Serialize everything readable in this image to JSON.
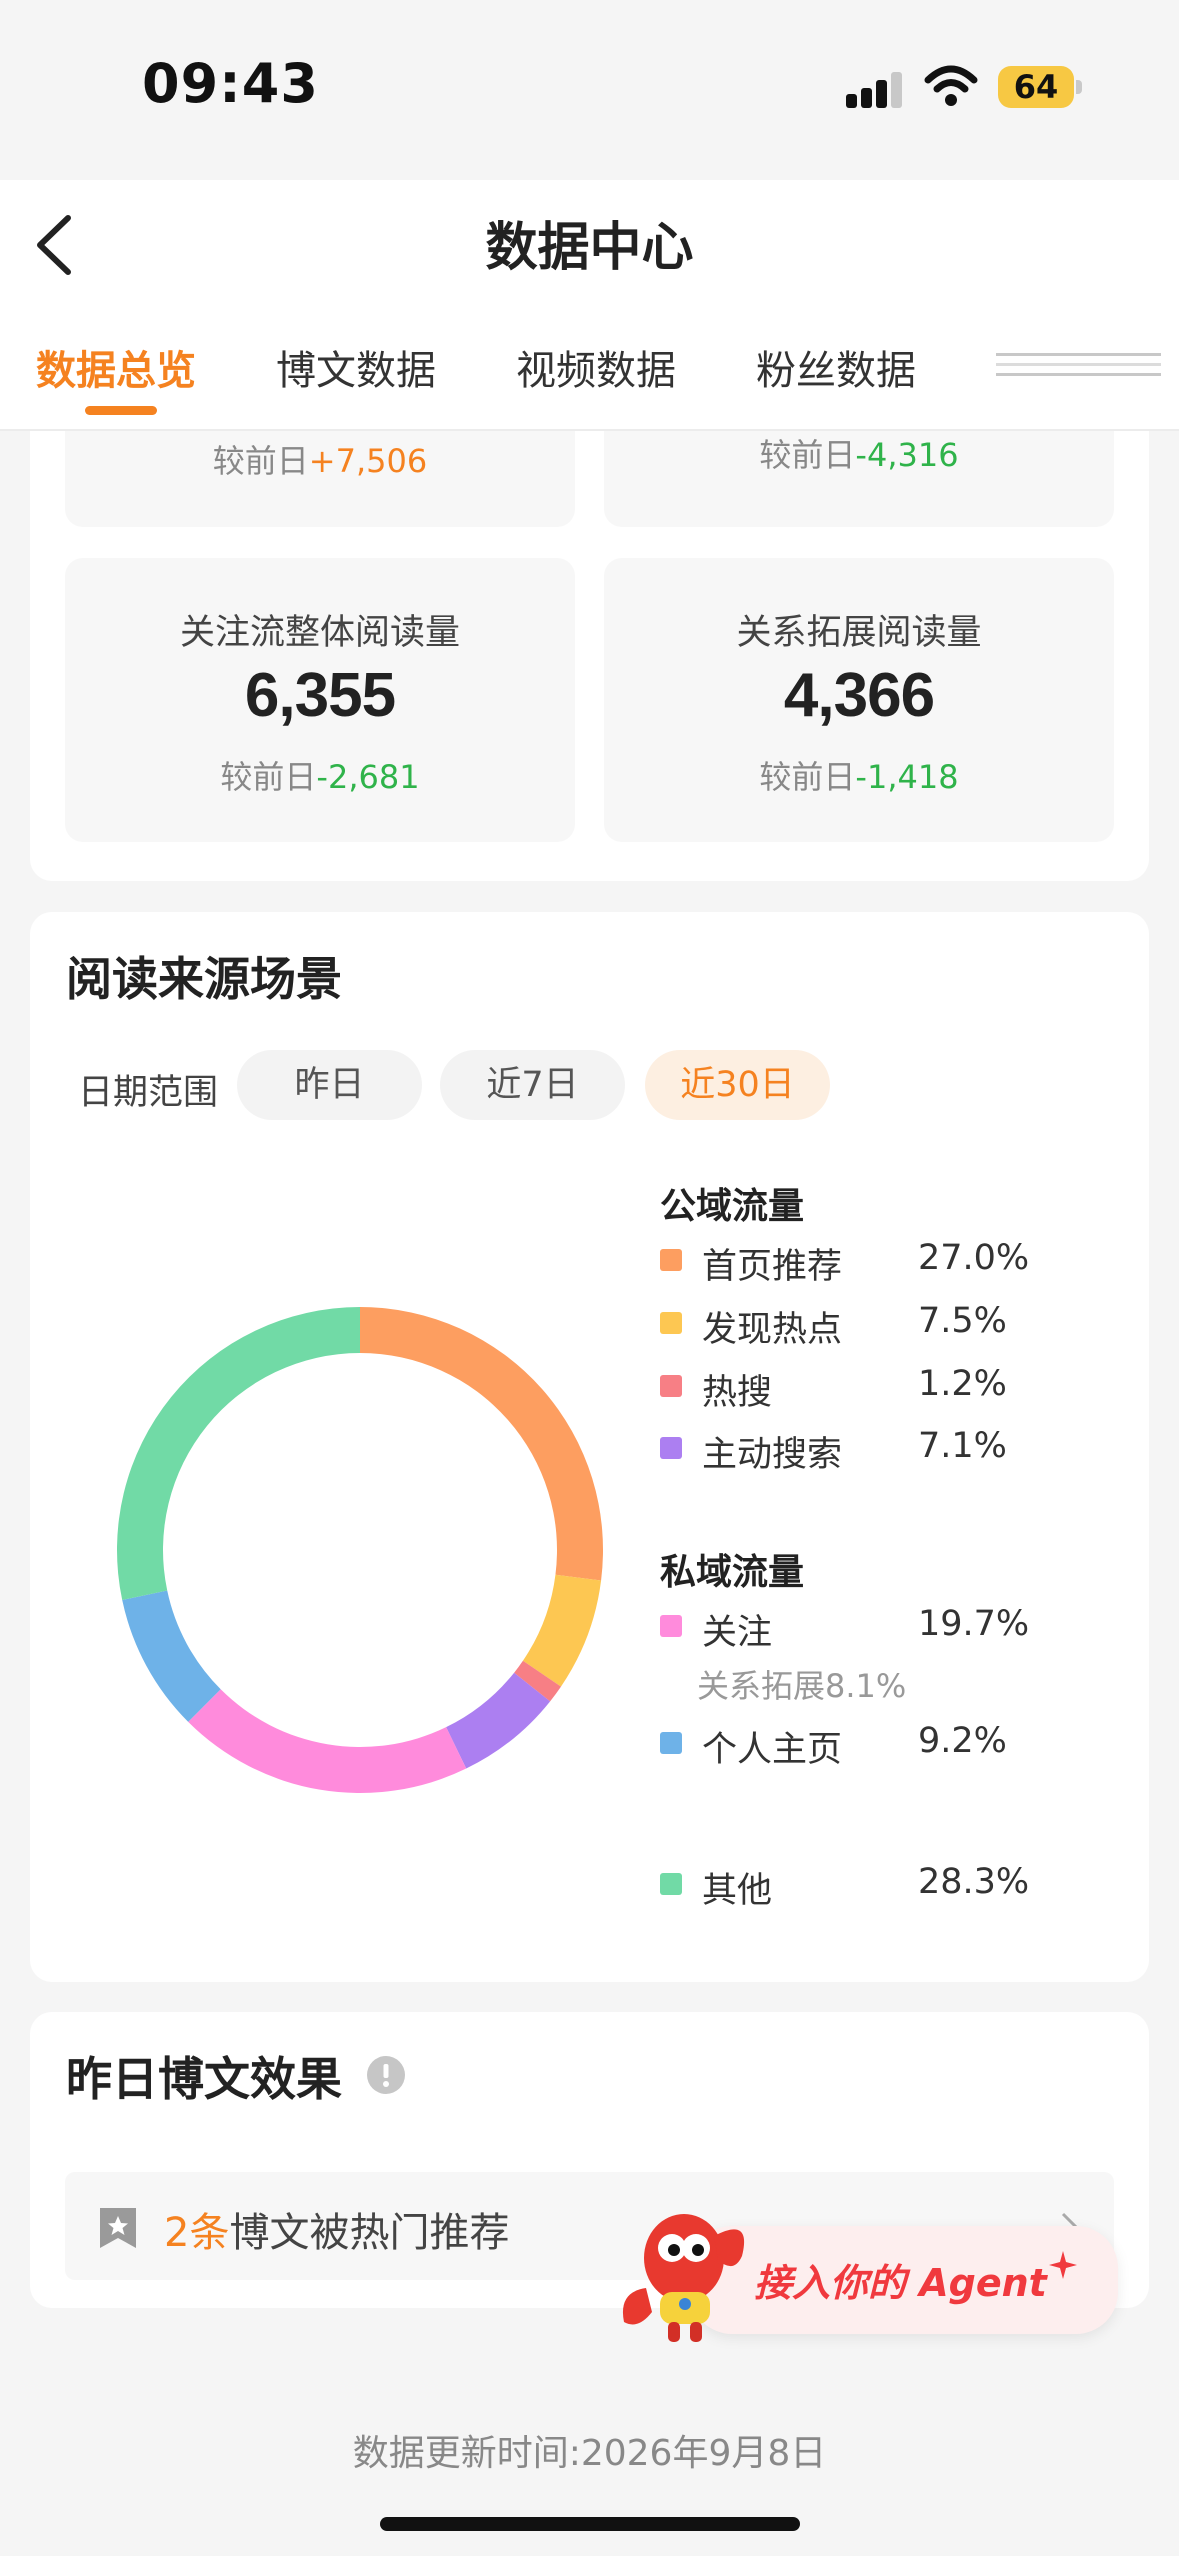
{
  "status_bar": {
    "time": "09:43",
    "battery": "64"
  },
  "header": {
    "title": "数据中心",
    "tabs": [
      {
        "label": "数据总览",
        "active": true
      },
      {
        "label": "博文数据",
        "active": false
      },
      {
        "label": "视频数据",
        "active": false
      },
      {
        "label": "粉丝数据",
        "active": false
      }
    ]
  },
  "overview": {
    "top_partial": [
      {
        "delta_label": "较前日",
        "delta": "+7,506"
      },
      {
        "delta_label": "较前日",
        "delta": "-4,316"
      }
    ],
    "stats": [
      {
        "label": "关注流整体阅读量",
        "value": "6,355",
        "delta_label": "较前日",
        "delta": "-2,681"
      },
      {
        "label": "关系拓展阅读量",
        "value": "4,366",
        "delta_label": "较前日",
        "delta": "-1,418"
      }
    ]
  },
  "sources": {
    "title": "阅读来源场景",
    "range_label": "日期范围",
    "ranges": [
      {
        "label": "昨日",
        "active": false
      },
      {
        "label": "近7日",
        "active": false
      },
      {
        "label": "近30日",
        "active": true
      }
    ],
    "public_title": "公域流量",
    "private_title": "私域流量",
    "public_items": [
      {
        "name": "首页推荐",
        "value": "27.0%",
        "color": "#fd9e60"
      },
      {
        "name": "发现热点",
        "value": "7.5%",
        "color": "#fdc752"
      },
      {
        "name": "热搜",
        "value": "1.2%",
        "color": "#f77f85"
      },
      {
        "name": "主动搜索",
        "value": "7.1%",
        "color": "#ac7ff1"
      }
    ],
    "private_items": [
      {
        "name": "关注",
        "value": "19.7%",
        "color": "#ff8bdc",
        "sub": "关系拓展8.1%"
      },
      {
        "name": "个人主页",
        "value": "9.2%",
        "color": "#6eb2e8"
      }
    ],
    "other_item": {
      "name": "其他",
      "value": "28.3%",
      "color": "#71daa6"
    }
  },
  "chart_data": {
    "type": "pie",
    "labels": [
      "首页推荐",
      "发现热点",
      "热搜",
      "主动搜索",
      "关注",
      "个人主页",
      "其他"
    ],
    "values": [
      27.0,
      7.5,
      1.2,
      7.1,
      19.7,
      9.2,
      28.3
    ],
    "colors": [
      "#fd9e60",
      "#fdc752",
      "#f77f85",
      "#ac7ff1",
      "#ff8bdc",
      "#6eb2e8",
      "#71daa6"
    ]
  },
  "yesterday": {
    "title": "昨日博文效果",
    "hot_count": "2条",
    "hot_text": "博文被热门推荐"
  },
  "agent_banner": {
    "text": "接入你的 Agent"
  },
  "footer": {
    "update_label": "数据更新时间:",
    "update_date": "2026年9月8日"
  }
}
